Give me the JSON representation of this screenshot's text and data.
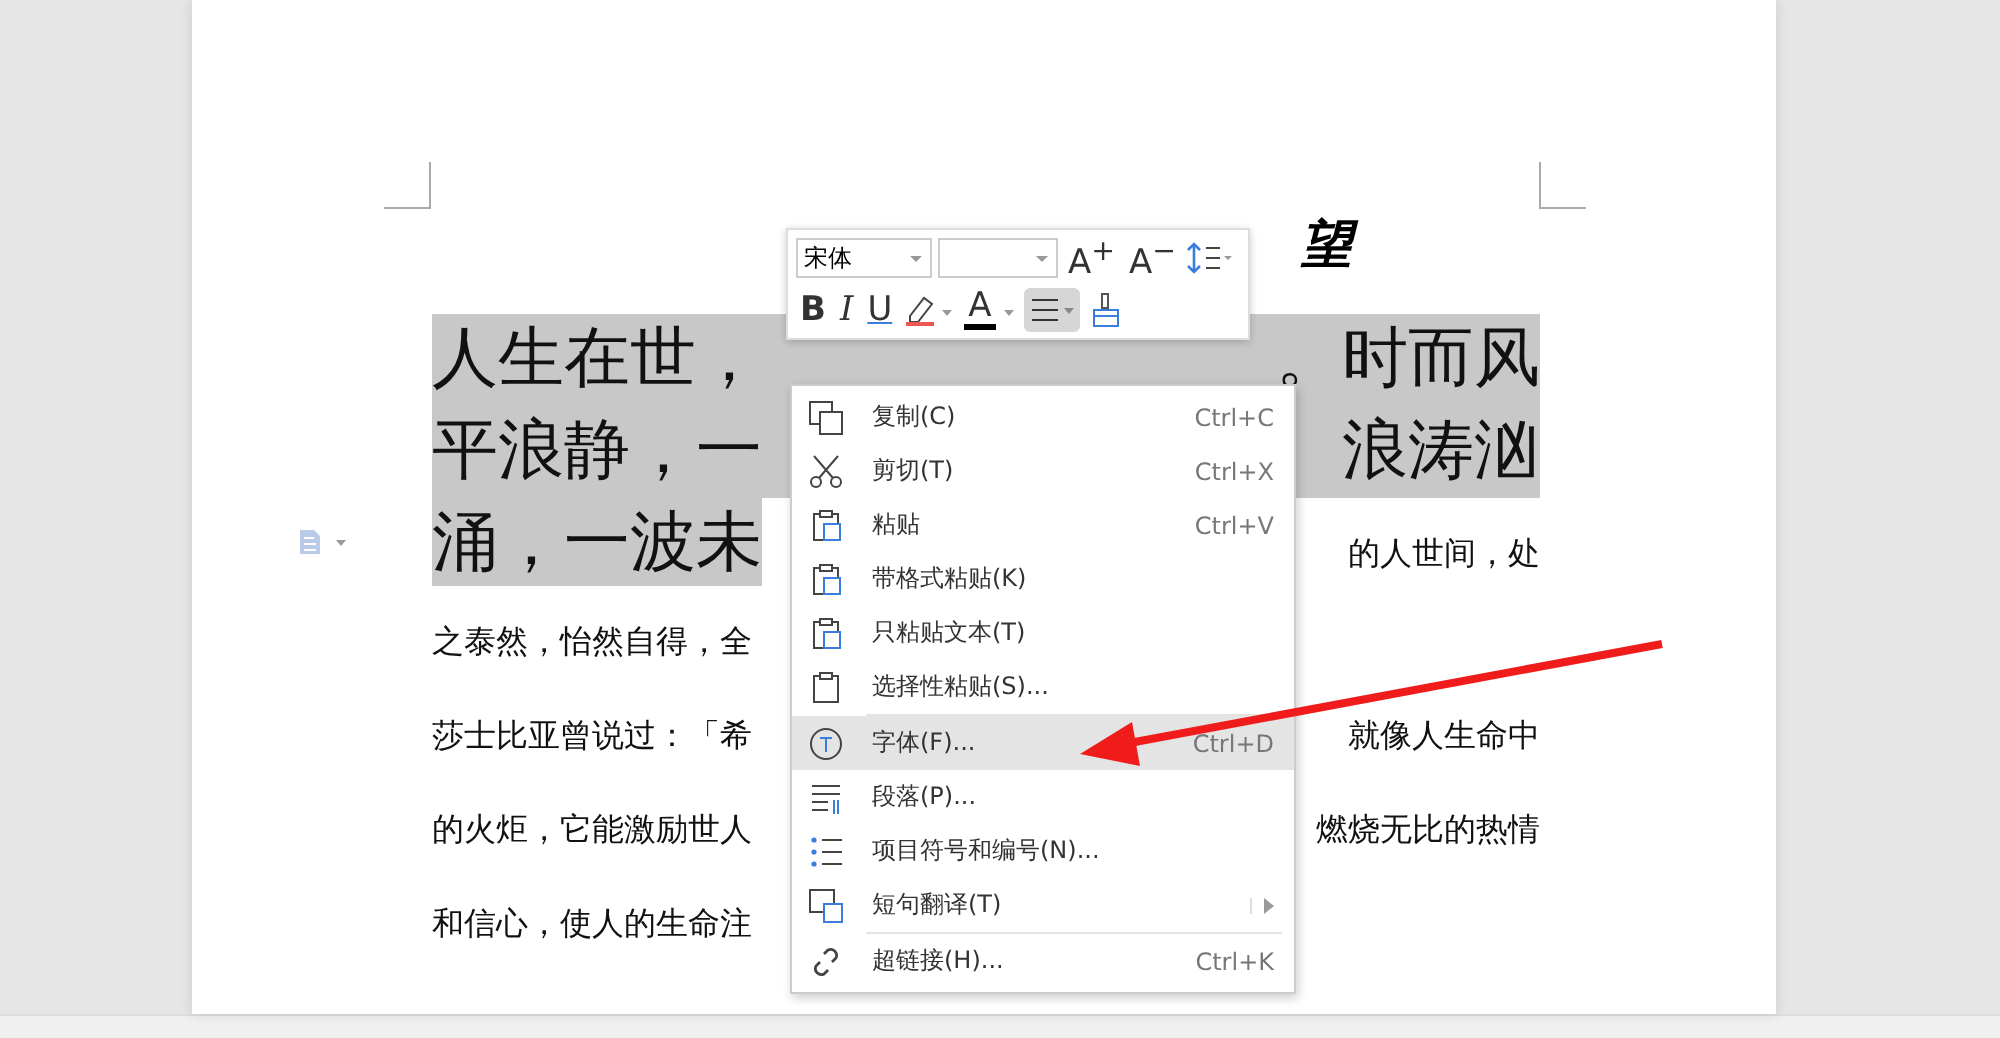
{
  "document": {
    "title": "望",
    "lines": [
      {
        "kind": "large",
        "left": "人生在世，",
        "right": "。时而风",
        "selected": true
      },
      {
        "kind": "large",
        "left": "平浪静，一",
        "right": "浪涛汹",
        "selected": true
      },
      {
        "kind": "mixed",
        "left": "涌，一波未",
        "right": "的人世间，处",
        "selected": true
      },
      {
        "kind": "small",
        "left": "之泰然，怡然自得，全",
        "selected": false
      },
      {
        "kind": "small",
        "left": "莎士比亚曾说过：「希",
        "right": "就像人生命中",
        "selected": false
      },
      {
        "kind": "small",
        "left": "的火炬，它能激励世人",
        "right": "燃烧无比的热情",
        "selected": false
      },
      {
        "kind": "small",
        "left": "和信心，使人的生命注",
        "selected": false
      }
    ]
  },
  "mini_toolbar": {
    "font_name": "宋体",
    "grow_label": "A$^{+}$",
    "shrink_label": "A$^{−}$",
    "bold_label": "B",
    "italic_label": "I",
    "underline_label": "U",
    "font_color_label": "A",
    "align_selected": true
  },
  "context_menu": [
    {
      "kind": "item",
      "label": "复制(C)",
      "shortcut": "Ctrl+C",
      "selected": false
    },
    {
      "kind": "item",
      "label": "剪切(T)",
      "shortcut": "Ctrl+X",
      "selected": false
    },
    {
      "kind": "item",
      "label": "粘贴",
      "shortcut": "Ctrl+V",
      "selected": false
    },
    {
      "kind": "item",
      "label": "带格式粘贴(K)",
      "selected": false
    },
    {
      "kind": "item",
      "label": "只粘贴文本(T)",
      "selected": false
    },
    {
      "kind": "item",
      "label": "选择性粘贴(S)...",
      "selected": false
    },
    {
      "kind": "separator"
    },
    {
      "kind": "item",
      "label": "字体(F)...",
      "shortcut": "Ctrl+D",
      "selected": true
    },
    {
      "kind": "item",
      "label": "段落(P)...",
      "selected": false
    },
    {
      "kind": "item",
      "label": "项目符号和编号(N)...",
      "selected": false
    },
    {
      "kind": "submenu",
      "label": "短句翻译(T)",
      "selected": false
    },
    {
      "kind": "separator"
    },
    {
      "kind": "item",
      "label": "超链接(H)...",
      "shortcut": "Ctrl+K",
      "selected": false
    }
  ]
}
